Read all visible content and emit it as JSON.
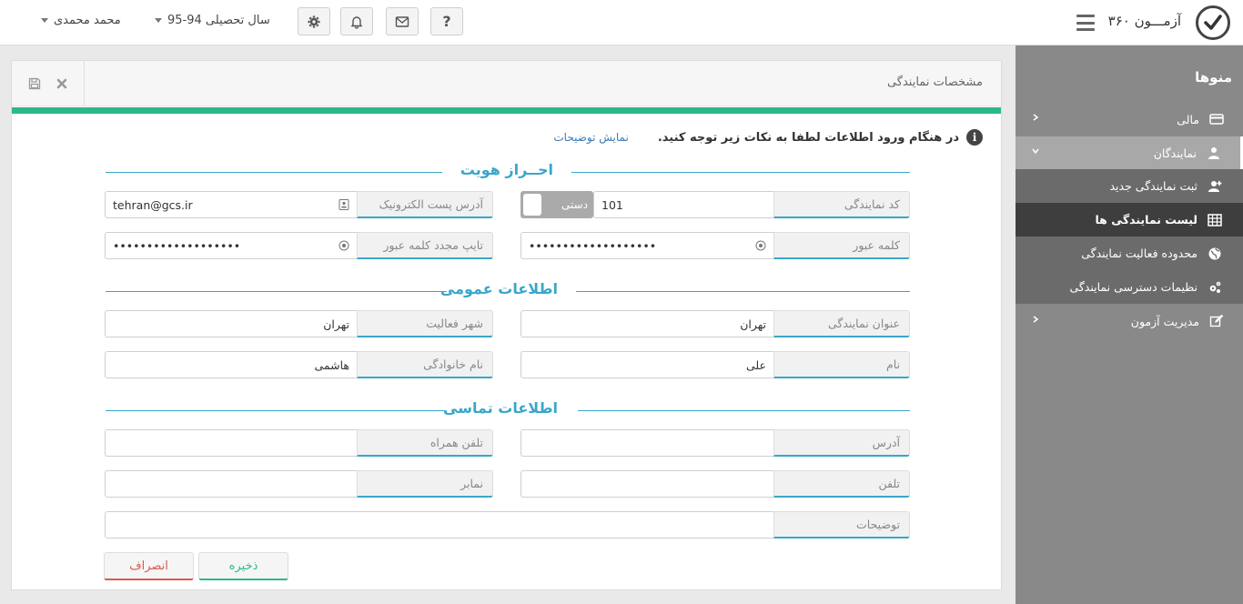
{
  "header": {
    "logo_text": "آزمـــون ۳۶۰",
    "help_label": "?",
    "year_label": "سال تحصیلی 94-95",
    "user_name": "محمد محمدی"
  },
  "sidebar": {
    "title": "منوها",
    "items": [
      {
        "label": "مالی"
      },
      {
        "label": "نمایندگان"
      },
      {
        "label": "مدیریت آزمون"
      }
    ],
    "subitems": [
      {
        "label": "ثبت نمایندگی جدید"
      },
      {
        "label": "لیست نمایندگی ها"
      },
      {
        "label": "محدوده فعالیت نمایندگی"
      },
      {
        "label": "نظیمات دسترسی نمایندگی"
      }
    ]
  },
  "panel": {
    "title": "مشخصات نمایندگی",
    "info_icon": "i",
    "info_text": "در هنگام ورود اطلاعات لطفا به نکات زیر توجه کنید.",
    "info_link": "نمایش توضیحات"
  },
  "sections": {
    "identity": "احــراز هویت",
    "general": "اطلاعات عمومی",
    "contact": "اطلاعات تماسی"
  },
  "fields": {
    "agency_code": {
      "label": "کد نمایندگی",
      "value": "101"
    },
    "toggle_label": "دستی",
    "email": {
      "label": "آدرس پست الکترونیک",
      "value": "tehran@gcs.ir"
    },
    "password": {
      "label": "کلمه عبور",
      "value": "•••••••••••••••••••"
    },
    "password_repeat": {
      "label": "تایپ مجدد کلمه عبور",
      "value": "•••••••••••••••••••"
    },
    "agency_title": {
      "label": "عنوان نمایندگی",
      "value": "تهران"
    },
    "activity_city": {
      "label": "شهر فعالیت",
      "value": "تهران"
    },
    "first_name": {
      "label": "نام",
      "value": "علی"
    },
    "last_name": {
      "label": "نام خانوادگی",
      "value": "هاشمی"
    },
    "address": {
      "label": "آدرس",
      "value": ""
    },
    "mobile": {
      "label": "تلفن همراه",
      "value": ""
    },
    "phone": {
      "label": "تلفن",
      "value": ""
    },
    "fax": {
      "label": "نمابر",
      "value": ""
    },
    "description": {
      "label": "توضیحات",
      "value": ""
    }
  },
  "buttons": {
    "save": "ذخیره",
    "cancel": "انصراف"
  },
  "colors": {
    "accent": "#3aa6c9",
    "success": "#2bb98a",
    "danger": "#e0574f",
    "sidebar": "#898989"
  }
}
